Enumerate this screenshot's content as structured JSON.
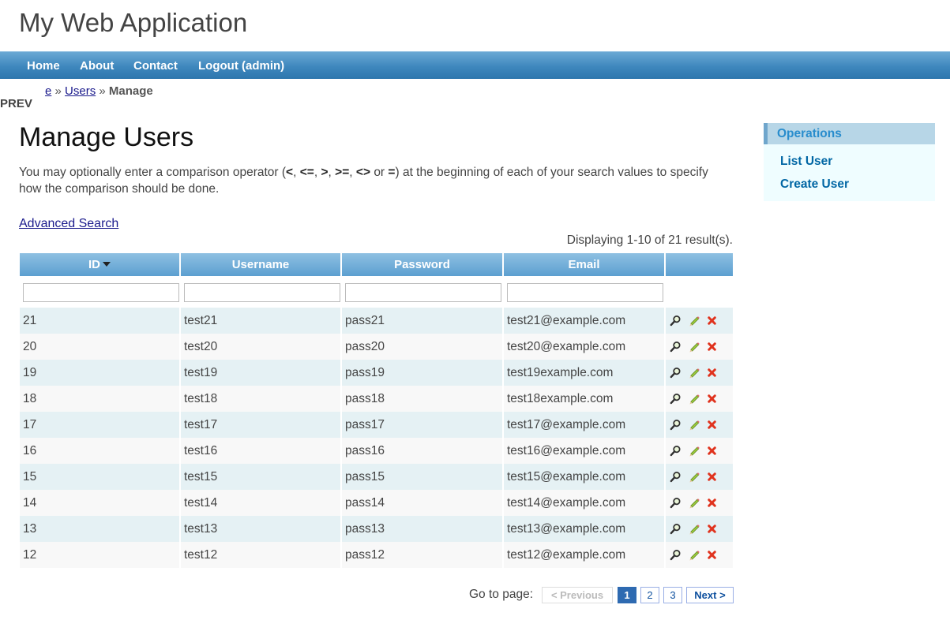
{
  "app": {
    "title": "My Web Application"
  },
  "menu": {
    "items": [
      "Home",
      "About",
      "Contact",
      "Logout (admin)"
    ]
  },
  "breadcrumb": {
    "home": "e",
    "sep1": "»",
    "users": "Users",
    "sep2": "»",
    "current": "Manage"
  },
  "prev_label": "PREV",
  "page": {
    "title": "Manage Users",
    "desc_a": "You may optionally enter a comparison operator (",
    "ops": [
      "<",
      "<=",
      ">",
      ">=",
      "<>",
      "="
    ],
    "desc_or": "or",
    "desc_b": ") at the beginning of each of your search values to specify how the comparison should be done.",
    "advanced_search": "Advanced Search",
    "summary": "Displaying 1-10 of 21 result(s)."
  },
  "table": {
    "columns": [
      "ID",
      "Username",
      "Password",
      "Email"
    ],
    "sorted_column": "ID",
    "rows": [
      {
        "id": "21",
        "username": "test21",
        "password": "pass21",
        "email": "test21@example.com"
      },
      {
        "id": "20",
        "username": "test20",
        "password": "pass20",
        "email": "test20@example.com"
      },
      {
        "id": "19",
        "username": "test19",
        "password": "pass19",
        "email": "test19example.com"
      },
      {
        "id": "18",
        "username": "test18",
        "password": "pass18",
        "email": "test18example.com"
      },
      {
        "id": "17",
        "username": "test17",
        "password": "pass17",
        "email": "test17@example.com"
      },
      {
        "id": "16",
        "username": "test16",
        "password": "pass16",
        "email": "test16@example.com"
      },
      {
        "id": "15",
        "username": "test15",
        "password": "pass15",
        "email": "test15@example.com"
      },
      {
        "id": "14",
        "username": "test14",
        "password": "pass14",
        "email": "test14@example.com"
      },
      {
        "id": "13",
        "username": "test13",
        "password": "pass13",
        "email": "test13@example.com"
      },
      {
        "id": "12",
        "username": "test12",
        "password": "pass12",
        "email": "test12@example.com"
      }
    ],
    "row_actions": [
      "view-icon",
      "update-icon",
      "delete-icon"
    ]
  },
  "pager": {
    "label": "Go to page:",
    "previous": "< Previous",
    "pages": [
      "1",
      "2",
      "3"
    ],
    "current": "1",
    "next": "Next >"
  },
  "sidebar": {
    "title": "Operations",
    "items": [
      "List User",
      "Create User"
    ]
  },
  "colors": {
    "menu_bar": "#3e87bd",
    "header": "#5c9fd0",
    "row_odd": "#e5f1f4",
    "row_even": "#f8f8f8",
    "link": "#1a1a8c",
    "portlet_bg": "#effdff"
  }
}
